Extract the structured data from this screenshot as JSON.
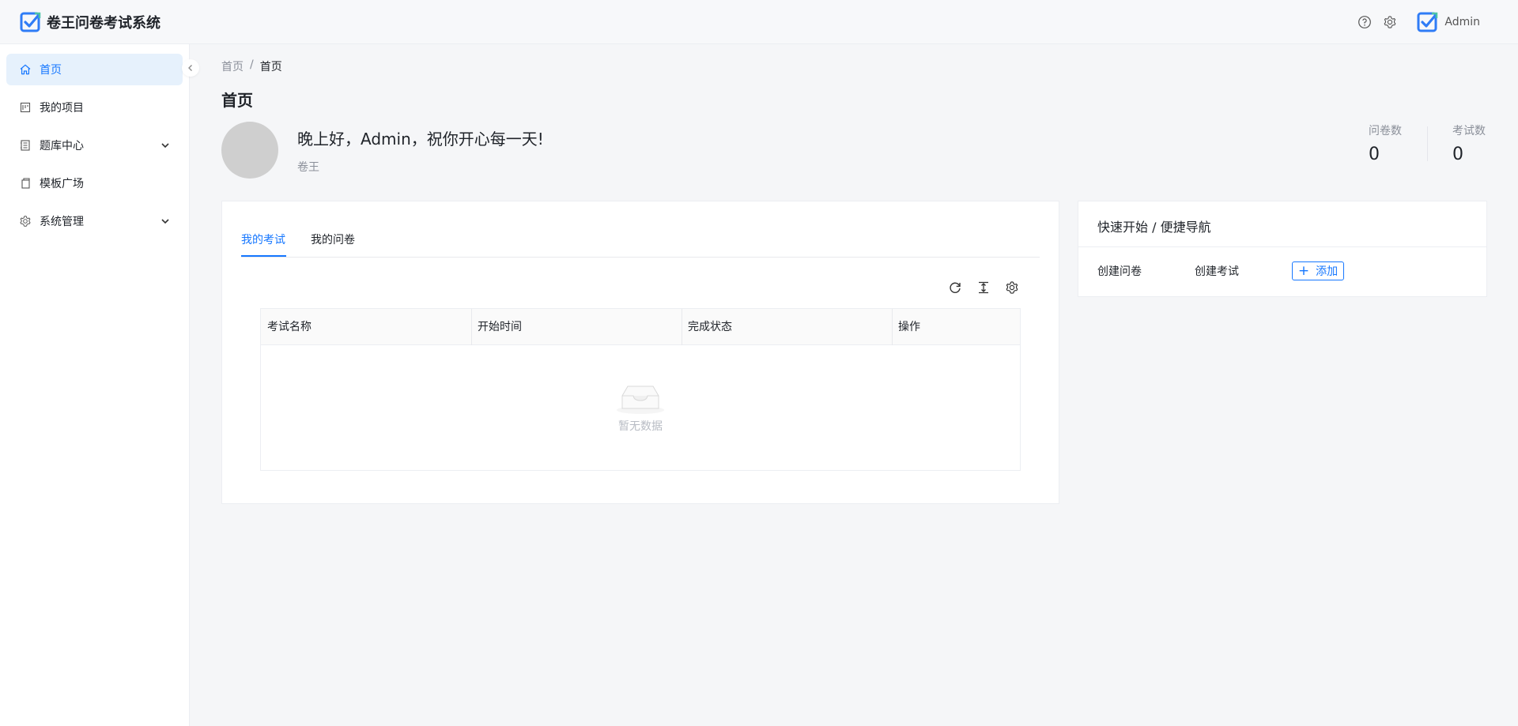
{
  "app": {
    "title": "卷王问卷考试系统"
  },
  "header": {
    "user_name": "Admin"
  },
  "sidebar": {
    "items": [
      {
        "label": "首页",
        "icon": "home-icon",
        "active": true
      },
      {
        "label": "我的项目",
        "icon": "project-icon"
      },
      {
        "label": "题库中心",
        "icon": "question-bank-icon",
        "expandable": true
      },
      {
        "label": "模板广场",
        "icon": "template-icon"
      },
      {
        "label": "系统管理",
        "icon": "gear-icon",
        "expandable": true
      }
    ]
  },
  "breadcrumb": {
    "root": "首页",
    "separator": "/",
    "current": "首页"
  },
  "page": {
    "title": "首页"
  },
  "welcome": {
    "greeting": "晚上好，Admin，祝你开心每一天!",
    "subtitle": "卷王"
  },
  "stats": [
    {
      "label": "问卷数",
      "value": "0"
    },
    {
      "label": "考试数",
      "value": "0"
    }
  ],
  "tabs": [
    {
      "label": "我的考试",
      "active": true
    },
    {
      "label": "我的问卷"
    }
  ],
  "table": {
    "columns": [
      "考试名称",
      "开始时间",
      "完成状态",
      "操作"
    ],
    "empty_text": "暂无数据"
  },
  "quick_nav": {
    "title": "快速开始 / 便捷导航",
    "links": [
      "创建问卷",
      "创建考试"
    ],
    "add_label": "添加"
  },
  "colors": {
    "accent": "#1677ff",
    "active_bg": "#e6f1fc"
  }
}
